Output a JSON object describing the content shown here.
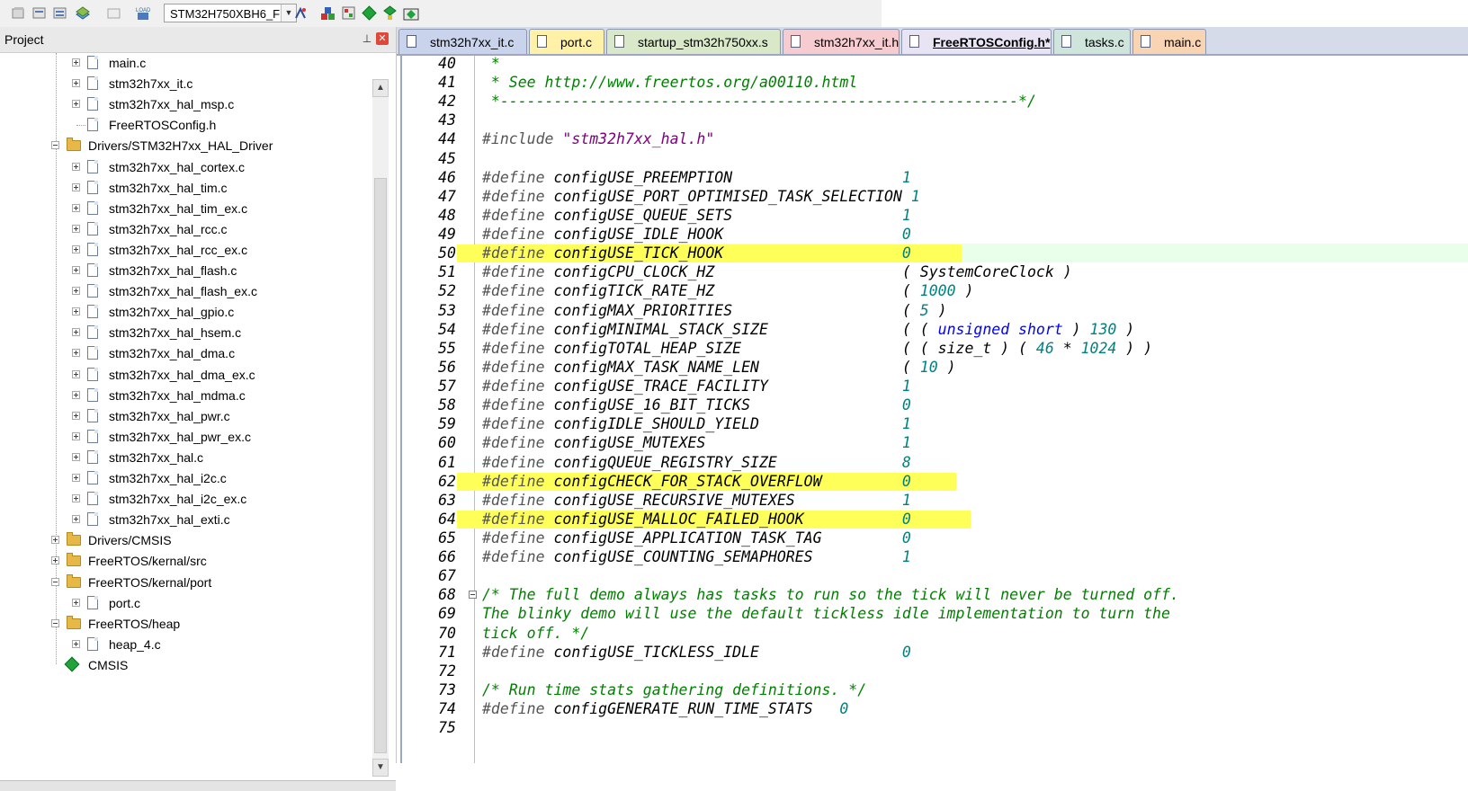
{
  "toolbar": {
    "target": "STM32H750XBH6_F",
    "icons": [
      "translate-icon",
      "build-icon",
      "rebuild-icon",
      "batch-build-icon",
      "stop-build-icon",
      "load-icon",
      "target-options-icon",
      "manage-components-icon",
      "manage-project-icon",
      "select-packs-icon",
      "run-environment-icon",
      "pack-installer-icon"
    ]
  },
  "project_panel": {
    "title": "Project",
    "tree": [
      {
        "label": "main.c",
        "level": 2,
        "kind": "file",
        "expander": "plus"
      },
      {
        "label": "stm32h7xx_it.c",
        "level": 2,
        "kind": "file",
        "expander": "plus"
      },
      {
        "label": "stm32h7xx_hal_msp.c",
        "level": 2,
        "kind": "file",
        "expander": "plus"
      },
      {
        "label": "FreeRTOSConfig.h",
        "level": 2,
        "kind": "file",
        "expander": "none"
      },
      {
        "label": "Drivers/STM32H7xx_HAL_Driver",
        "level": 1,
        "kind": "folder",
        "expander": "minus"
      },
      {
        "label": "stm32h7xx_hal_cortex.c",
        "level": 2,
        "kind": "file",
        "expander": "plus"
      },
      {
        "label": "stm32h7xx_hal_tim.c",
        "level": 2,
        "kind": "file",
        "expander": "plus"
      },
      {
        "label": "stm32h7xx_hal_tim_ex.c",
        "level": 2,
        "kind": "file",
        "expander": "plus"
      },
      {
        "label": "stm32h7xx_hal_rcc.c",
        "level": 2,
        "kind": "file",
        "expander": "plus"
      },
      {
        "label": "stm32h7xx_hal_rcc_ex.c",
        "level": 2,
        "kind": "file",
        "expander": "plus"
      },
      {
        "label": "stm32h7xx_hal_flash.c",
        "level": 2,
        "kind": "file",
        "expander": "plus"
      },
      {
        "label": "stm32h7xx_hal_flash_ex.c",
        "level": 2,
        "kind": "file",
        "expander": "plus"
      },
      {
        "label": "stm32h7xx_hal_gpio.c",
        "level": 2,
        "kind": "file",
        "expander": "plus"
      },
      {
        "label": "stm32h7xx_hal_hsem.c",
        "level": 2,
        "kind": "file",
        "expander": "plus"
      },
      {
        "label": "stm32h7xx_hal_dma.c",
        "level": 2,
        "kind": "file",
        "expander": "plus"
      },
      {
        "label": "stm32h7xx_hal_dma_ex.c",
        "level": 2,
        "kind": "file",
        "expander": "plus"
      },
      {
        "label": "stm32h7xx_hal_mdma.c",
        "level": 2,
        "kind": "file",
        "expander": "plus"
      },
      {
        "label": "stm32h7xx_hal_pwr.c",
        "level": 2,
        "kind": "file",
        "expander": "plus"
      },
      {
        "label": "stm32h7xx_hal_pwr_ex.c",
        "level": 2,
        "kind": "file",
        "expander": "plus"
      },
      {
        "label": "stm32h7xx_hal.c",
        "level": 2,
        "kind": "file",
        "expander": "plus"
      },
      {
        "label": "stm32h7xx_hal_i2c.c",
        "level": 2,
        "kind": "file",
        "expander": "plus"
      },
      {
        "label": "stm32h7xx_hal_i2c_ex.c",
        "level": 2,
        "kind": "file",
        "expander": "plus"
      },
      {
        "label": "stm32h7xx_hal_exti.c",
        "level": 2,
        "kind": "file",
        "expander": "plus"
      },
      {
        "label": "Drivers/CMSIS",
        "level": 1,
        "kind": "folder",
        "expander": "plus"
      },
      {
        "label": "FreeRTOS/kernal/src",
        "level": 1,
        "kind": "folder",
        "expander": "plus"
      },
      {
        "label": "FreeRTOS/kernal/port",
        "level": 1,
        "kind": "folder",
        "expander": "minus"
      },
      {
        "label": "port.c",
        "level": 2,
        "kind": "file",
        "expander": "plus"
      },
      {
        "label": "FreeRTOS/heap",
        "level": 1,
        "kind": "folder",
        "expander": "minus"
      },
      {
        "label": "heap_4.c",
        "level": 2,
        "kind": "file",
        "expander": "plus"
      },
      {
        "label": "CMSIS",
        "level": 1,
        "kind": "component",
        "expander": "none"
      }
    ]
  },
  "tabs": [
    {
      "label": "stm32h7xx_it.c",
      "color": "#c9d4ec",
      "active": false
    },
    {
      "label": "port.c",
      "color": "#fff2a8",
      "active": false
    },
    {
      "label": "startup_stm32h750xx.s",
      "color": "#d9e8c9",
      "active": false
    },
    {
      "label": "stm32h7xx_it.h",
      "color": "#f6ccd0",
      "active": false
    },
    {
      "label": "FreeRTOSConfig.h*",
      "color": "#e9e4f3",
      "active": true
    },
    {
      "label": "tasks.c",
      "color": "#cfe5dc",
      "active": false
    },
    {
      "label": "main.c",
      "color": "#f8d4b2",
      "active": false
    }
  ],
  "editor": {
    "lines": [
      {
        "n": "40",
        "segs": [
          [
            " *",
            "cmt"
          ]
        ]
      },
      {
        "n": "41",
        "segs": [
          [
            " * See http://www.freertos.org/a00110.html",
            "cmt"
          ]
        ]
      },
      {
        "n": "42",
        "segs": [
          [
            " *----------------------------------------------------------*/",
            "cmt"
          ]
        ]
      },
      {
        "n": "43",
        "segs": []
      },
      {
        "n": "44",
        "segs": [
          [
            "#include ",
            "kw"
          ],
          [
            "\"stm32h7xx_hal.h\"",
            "str"
          ]
        ]
      },
      {
        "n": "45",
        "segs": []
      },
      {
        "n": "46",
        "segs": [
          [
            "#define ",
            "kw"
          ],
          [
            "configUSE_PREEMPTION                   ",
            ""
          ],
          [
            "1",
            "num"
          ]
        ]
      },
      {
        "n": "47",
        "segs": [
          [
            "#define ",
            "kw"
          ],
          [
            "configUSE_PORT_OPTIMISED_TASK_SELECTION ",
            ""
          ],
          [
            "1",
            "num"
          ]
        ]
      },
      {
        "n": "48",
        "segs": [
          [
            "#define ",
            "kw"
          ],
          [
            "configUSE_QUEUE_SETS                   ",
            ""
          ],
          [
            "1",
            "num"
          ]
        ]
      },
      {
        "n": "49",
        "segs": [
          [
            "#define ",
            "kw"
          ],
          [
            "configUSE_IDLE_HOOK                    ",
            ""
          ],
          [
            "0",
            "num"
          ]
        ]
      },
      {
        "n": "50",
        "segs": [
          [
            "#define ",
            "kw"
          ],
          [
            "configUSE_TICK_HOOK                    ",
            ""
          ],
          [
            "0",
            "num"
          ]
        ],
        "current": true
      },
      {
        "n": "51",
        "segs": [
          [
            "#define ",
            "kw"
          ],
          [
            "configCPU_CLOCK_HZ                     ",
            ""
          ],
          [
            "( SystemCoreClock )",
            ""
          ]
        ]
      },
      {
        "n": "52",
        "segs": [
          [
            "#define ",
            "kw"
          ],
          [
            "configTICK_RATE_HZ                     ",
            ""
          ],
          [
            "( ",
            ""
          ],
          [
            "1000",
            "num"
          ],
          [
            " )",
            ""
          ]
        ]
      },
      {
        "n": "53",
        "segs": [
          [
            "#define ",
            "kw"
          ],
          [
            "configMAX_PRIORITIES                   ",
            ""
          ],
          [
            "( ",
            ""
          ],
          [
            "5",
            "num"
          ],
          [
            " )",
            ""
          ]
        ]
      },
      {
        "n": "54",
        "segs": [
          [
            "#define ",
            "kw"
          ],
          [
            "configMINIMAL_STACK_SIZE               ",
            ""
          ],
          [
            "( ( ",
            ""
          ],
          [
            "unsigned short",
            "utype"
          ],
          [
            " ) ",
            ""
          ],
          [
            "130",
            "num"
          ],
          [
            " )",
            ""
          ]
        ]
      },
      {
        "n": "55",
        "segs": [
          [
            "#define ",
            "kw"
          ],
          [
            "configTOTAL_HEAP_SIZE                  ",
            ""
          ],
          [
            "( ( size_t ) ( ",
            ""
          ],
          [
            "46",
            "num"
          ],
          [
            " * ",
            ""
          ],
          [
            "1024",
            "num"
          ],
          [
            " ) )",
            ""
          ]
        ]
      },
      {
        "n": "56",
        "segs": [
          [
            "#define ",
            "kw"
          ],
          [
            "configMAX_TASK_NAME_LEN                ",
            ""
          ],
          [
            "( ",
            ""
          ],
          [
            "10",
            "num"
          ],
          [
            " )",
            ""
          ]
        ]
      },
      {
        "n": "57",
        "segs": [
          [
            "#define ",
            "kw"
          ],
          [
            "configUSE_TRACE_FACILITY               ",
            ""
          ],
          [
            "1",
            "num"
          ]
        ]
      },
      {
        "n": "58",
        "segs": [
          [
            "#define ",
            "kw"
          ],
          [
            "configUSE_16_BIT_TICKS                 ",
            ""
          ],
          [
            "0",
            "num"
          ]
        ]
      },
      {
        "n": "59",
        "segs": [
          [
            "#define ",
            "kw"
          ],
          [
            "configIDLE_SHOULD_YIELD                ",
            ""
          ],
          [
            "1",
            "num"
          ]
        ]
      },
      {
        "n": "60",
        "segs": [
          [
            "#define ",
            "kw"
          ],
          [
            "configUSE_MUTEXES                      ",
            ""
          ],
          [
            "1",
            "num"
          ]
        ]
      },
      {
        "n": "61",
        "segs": [
          [
            "#define ",
            "kw"
          ],
          [
            "configQUEUE_REGISTRY_SIZE              ",
            ""
          ],
          [
            "8",
            "num"
          ]
        ]
      },
      {
        "n": "62",
        "segs": [
          [
            "#define ",
            "kw"
          ],
          [
            "configCHECK_FOR_STACK_OVERFLOW         ",
            ""
          ],
          [
            "0",
            "num"
          ]
        ]
      },
      {
        "n": "63",
        "segs": [
          [
            "#define ",
            "kw"
          ],
          [
            "configUSE_RECURSIVE_MUTEXES            ",
            ""
          ],
          [
            "1",
            "num"
          ]
        ]
      },
      {
        "n": "64",
        "segs": [
          [
            "#define ",
            "kw"
          ],
          [
            "configUSE_MALLOC_FAILED_HOOK           ",
            ""
          ],
          [
            "0",
            "num"
          ]
        ]
      },
      {
        "n": "65",
        "segs": [
          [
            "#define ",
            "kw"
          ],
          [
            "configUSE_APPLICATION_TASK_TAG         ",
            ""
          ],
          [
            "0",
            "num"
          ]
        ]
      },
      {
        "n": "66",
        "segs": [
          [
            "#define ",
            "kw"
          ],
          [
            "configUSE_COUNTING_SEMAPHORES          ",
            ""
          ],
          [
            "1",
            "num"
          ]
        ]
      },
      {
        "n": "67",
        "segs": []
      },
      {
        "n": "68",
        "segs": [
          [
            "/* The full demo always has tasks to run so the tick will never be turned off.",
            "cmt"
          ]
        ],
        "fold": true
      },
      {
        "n": "69",
        "segs": [
          [
            "The blinky demo will use the default tickless idle implementation to turn the",
            "cmt"
          ]
        ]
      },
      {
        "n": "70",
        "segs": [
          [
            "tick off. */",
            "cmt"
          ]
        ]
      },
      {
        "n": "71",
        "segs": [
          [
            "#define ",
            "kw"
          ],
          [
            "configUSE_TICKLESS_IDLE                ",
            ""
          ],
          [
            "0",
            "num"
          ]
        ]
      },
      {
        "n": "72",
        "segs": []
      },
      {
        "n": "73",
        "segs": [
          [
            "/* Run time stats gathering definitions. */",
            "cmt"
          ]
        ]
      },
      {
        "n": "74",
        "segs": [
          [
            "#define ",
            "kw"
          ],
          [
            "configGENERATE_RUN_TIME_STATS   ",
            ""
          ],
          [
            "0",
            "num"
          ]
        ]
      },
      {
        "n": "75",
        "segs": []
      }
    ]
  }
}
